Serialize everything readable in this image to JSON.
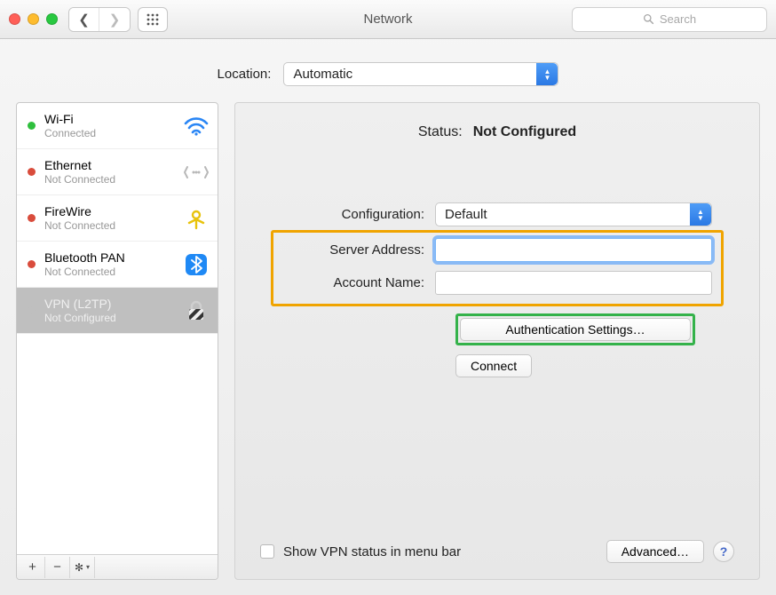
{
  "window": {
    "title": "Network"
  },
  "search": {
    "placeholder": "Search"
  },
  "location": {
    "label": "Location:",
    "value": "Automatic"
  },
  "services": [
    {
      "name": "Wi-Fi",
      "sub": "Connected",
      "status": "g",
      "icon": "wifi",
      "selected": false
    },
    {
      "name": "Ethernet",
      "sub": "Not Connected",
      "status": "r",
      "icon": "ethernet",
      "selected": false
    },
    {
      "name": "FireWire",
      "sub": "Not Connected",
      "status": "r",
      "icon": "firewire",
      "selected": false
    },
    {
      "name": "Bluetooth PAN",
      "sub": "Not Connected",
      "status": "r",
      "icon": "bluetooth",
      "selected": false
    },
    {
      "name": "VPN (L2TP)",
      "sub": "Not Configured",
      "status": "",
      "icon": "lock",
      "selected": true
    }
  ],
  "sidebar_buttons": {
    "add": "+",
    "remove": "−",
    "gear": "✻"
  },
  "detail": {
    "status_label": "Status:",
    "status_value": "Not Configured",
    "config_label": "Configuration:",
    "config_value": "Default",
    "server_label": "Server Address:",
    "server_value": "",
    "account_label": "Account Name:",
    "account_value": "",
    "auth_button": "Authentication Settings…",
    "connect_button": "Connect",
    "menubar_checkbox": "Show VPN status in menu bar",
    "advanced_button": "Advanced…",
    "help": "?"
  }
}
